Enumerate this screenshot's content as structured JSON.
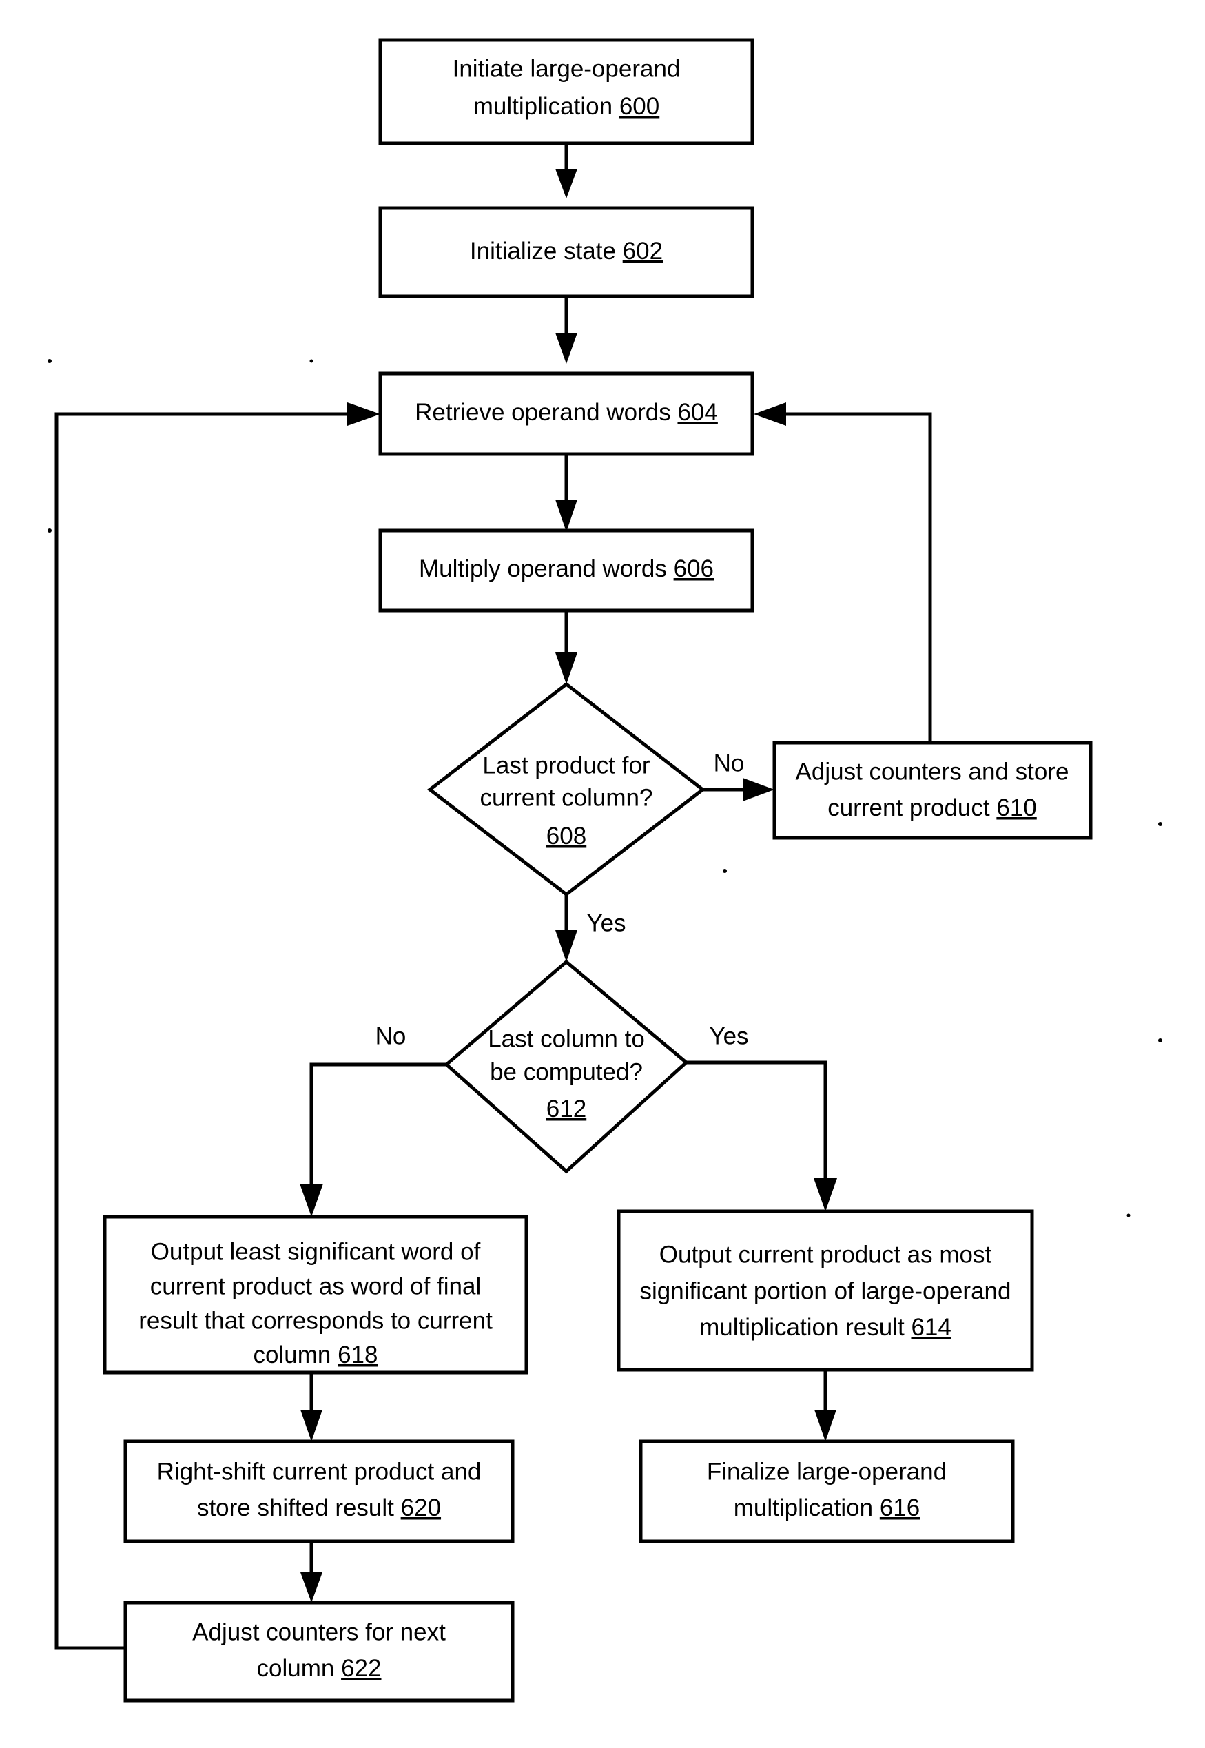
{
  "diagram": {
    "type": "flowchart",
    "title": "Large-operand multiplication flowchart",
    "nodes": [
      {
        "id": "600",
        "shape": "process",
        "ref": "600",
        "lines": [
          "Initiate large-operand",
          "multiplication"
        ],
        "text": "Initiate large-operand multiplication 600"
      },
      {
        "id": "602",
        "shape": "process",
        "ref": "602",
        "lines": [
          "Initialize state"
        ],
        "text": "Initialize state 602"
      },
      {
        "id": "604",
        "shape": "process",
        "ref": "604",
        "lines": [
          "Retrieve operand words"
        ],
        "text": "Retrieve operand words 604"
      },
      {
        "id": "606",
        "shape": "process",
        "ref": "606",
        "lines": [
          "Multiply operand words"
        ],
        "text": "Multiply operand words 606"
      },
      {
        "id": "608",
        "shape": "decision",
        "ref": "608",
        "lines": [
          "Last product for",
          "current column?"
        ],
        "text": "Last product for current column? 608"
      },
      {
        "id": "610",
        "shape": "process",
        "ref": "610",
        "lines": [
          "Adjust counters and store",
          "current product"
        ],
        "text": "Adjust counters and store current product 610"
      },
      {
        "id": "612",
        "shape": "decision",
        "ref": "612",
        "lines": [
          "Last column to",
          "be computed?"
        ],
        "text": "Last column to be computed? 612"
      },
      {
        "id": "614",
        "shape": "process",
        "ref": "614",
        "lines": [
          "Output current product as most",
          "significant portion of large-operand",
          "multiplication result"
        ],
        "text": "Output current product as most significant portion of large-operand multiplication result 614"
      },
      {
        "id": "616",
        "shape": "process",
        "ref": "616",
        "lines": [
          "Finalize large-operand",
          "multiplication"
        ],
        "text": "Finalize large-operand multiplication 616"
      },
      {
        "id": "618",
        "shape": "process",
        "ref": "618",
        "lines": [
          "Output least significant word of",
          "current product as word of final",
          "result that corresponds to current",
          "column"
        ],
        "text": "Output least significant word of current product as word of final result that corresponds to current column 618"
      },
      {
        "id": "620",
        "shape": "process",
        "ref": "620",
        "lines": [
          "Right-shift current product and",
          "store shifted result"
        ],
        "text": "Right-shift current product and store shifted result 620"
      },
      {
        "id": "622",
        "shape": "process",
        "ref": "622",
        "lines": [
          "Adjust counters for next",
          "column"
        ],
        "text": "Adjust counters for next column 622"
      }
    ],
    "edge_labels": {
      "e608_no": "No",
      "e608_yes": "Yes",
      "e612_no": "No",
      "e612_yes": "Yes"
    },
    "colors": {
      "stroke": "#000000",
      "fill": "#ffffff",
      "text": "#000000"
    }
  }
}
